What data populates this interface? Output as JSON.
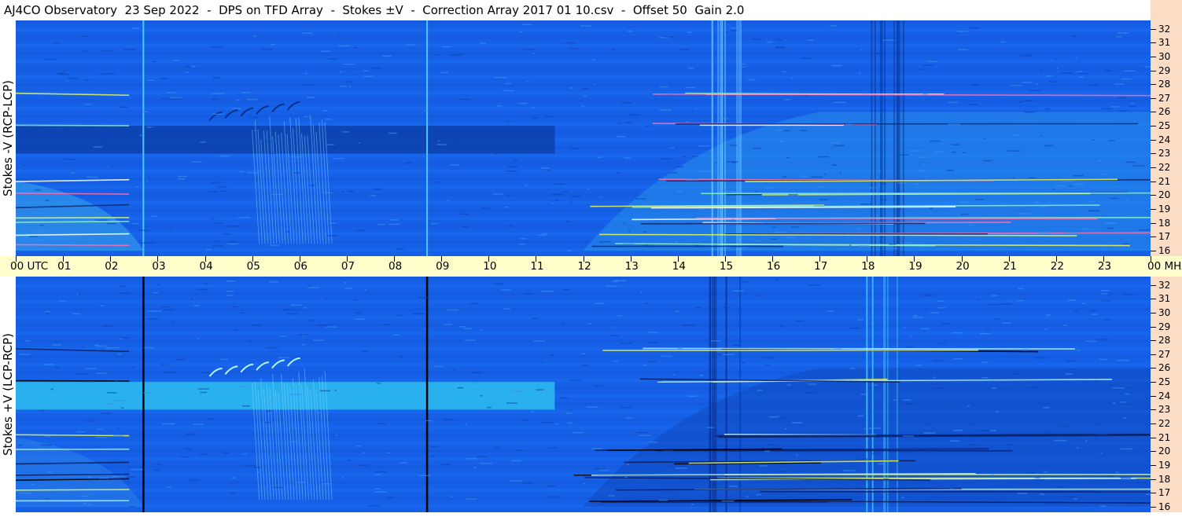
{
  "header": {
    "title": "AJ4CO Observatory  23 Sep 2022  -  DPS on TFD Array  -  Stokes ±V  -  Correction Array 2017 01 10.csv  -  Offset 50  Gain 2.0"
  },
  "panels": {
    "top_label": "Stokes -V (RCP-LCP)",
    "bottom_label": "Stokes +V (LCP-RCP)"
  },
  "colors": {
    "background_blue": "#1560e6",
    "dark_band": "#0b3fa8",
    "cyan_band": "#2fc4f0",
    "axis_strip": "#ffffcc",
    "freq_scale": "#fbdcc4"
  },
  "chart_data": [
    {
      "type": "heatmap",
      "title": "Stokes -V (RCP-LCP)",
      "xlabel": "UTC",
      "ylabel": "MHz",
      "x_ticks": [
        "00 UTC",
        "01",
        "02",
        "03",
        "04",
        "05",
        "06",
        "07",
        "08",
        "09",
        "10",
        "11",
        "12",
        "13",
        "14",
        "15",
        "16",
        "17",
        "18",
        "19",
        "20",
        "21",
        "22",
        "23",
        "00 MHz"
      ],
      "y_ticks": [
        "32",
        "31",
        "30",
        "29",
        "28",
        "27",
        "26",
        "25",
        "24",
        "23",
        "22",
        "21",
        "20",
        "19",
        "18",
        "17",
        "16"
      ],
      "xlim": [
        0,
        24
      ],
      "ylim": [
        16,
        32
      ],
      "features": {
        "dark_band_mhz": [
          23,
          25
        ],
        "dark_band_utc": [
          0,
          11.4
        ],
        "bright_vertical_lines_utc": [
          2.7,
          8.7
        ],
        "burst_activity_utc": [
          5,
          6.6
        ]
      }
    },
    {
      "type": "heatmap",
      "title": "Stokes +V (LCP-RCP)",
      "xlabel": "UTC",
      "ylabel": "MHz",
      "x_ticks": [
        "00 UTC",
        "01",
        "02",
        "03",
        "04",
        "05",
        "06",
        "07",
        "08",
        "09",
        "10",
        "11",
        "12",
        "13",
        "14",
        "15",
        "16",
        "17",
        "18",
        "19",
        "20",
        "21",
        "22",
        "23",
        "00 MHz"
      ],
      "y_ticks": [
        "32",
        "31",
        "30",
        "29",
        "28",
        "27",
        "26",
        "25",
        "24",
        "23",
        "22",
        "21",
        "20",
        "19",
        "18",
        "17",
        "16"
      ],
      "xlim": [
        0,
        24
      ],
      "ylim": [
        16,
        32
      ],
      "features": {
        "bright_band_mhz": [
          23,
          25
        ],
        "bright_band_utc": [
          0,
          11.4
        ],
        "dark_vertical_lines_utc": [
          2.7,
          8.7
        ],
        "burst_activity_utc": [
          5,
          6.6
        ]
      }
    }
  ]
}
